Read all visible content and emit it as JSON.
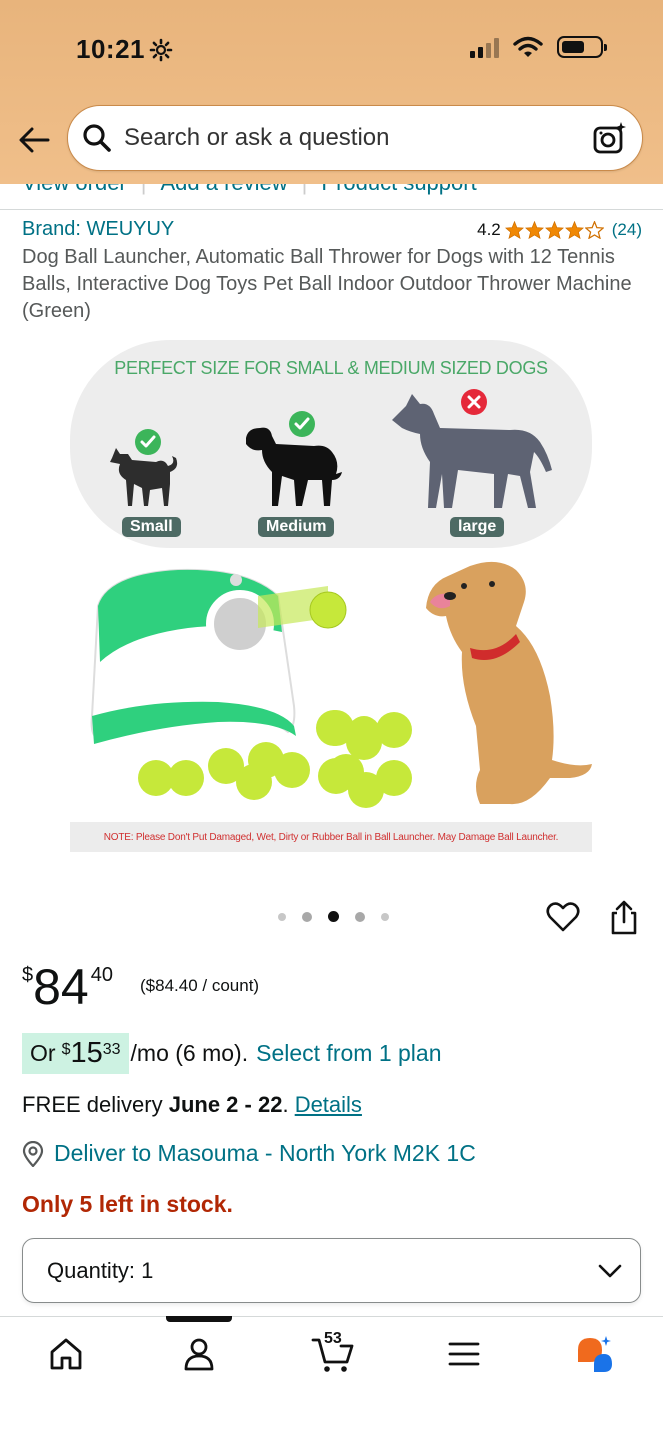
{
  "status_bar": {
    "time": "10:21"
  },
  "search": {
    "placeholder": "Search or ask a question"
  },
  "top_links": [
    "View order",
    "Add a review",
    "Product support"
  ],
  "product": {
    "brand": "Brand: WEUYUY",
    "rating_value": "4.2",
    "rating_stars": 4.2,
    "rating_count": "(24)",
    "title": "Dog Ball Launcher, Automatic Ball Thrower for Dogs with 12 Tennis Balls, Interactive Dog Toys Pet Ball Indoor Outdoor Thrower Machine (Green)"
  },
  "image": {
    "heading": "PERFECT SIZE FOR SMALL & MEDIUM SIZED DOGS",
    "size_labels": [
      "Small",
      "Medium",
      "large"
    ],
    "note": "NOTE: Please Don't Put Damaged, Wet, Dirty or Rubber Ball in Ball Launcher. May Damage Ball Launcher.",
    "carousel_total": 5,
    "carousel_active": 3
  },
  "price": {
    "currency": "$",
    "whole": "84",
    "fraction": "40",
    "unit": "($84.40 / count)"
  },
  "installment": {
    "or": "Or",
    "currency": "$",
    "whole": "15",
    "fraction": "33",
    "rest": "/mo (6 mo).",
    "link": "Select from 1 plan"
  },
  "delivery": {
    "prefix": "FREE delivery",
    "dates": "June 2 - 22",
    "period": ".",
    "details": "Details"
  },
  "deliver_to": "Deliver to Masouma - North York M2K 1C",
  "stock": "Only 5 left in stock.",
  "quantity": {
    "label": "Quantity:",
    "value": "1"
  },
  "bottom_nav": {
    "cart_count": "53",
    "items": [
      "home-icon",
      "account-icon",
      "cart-icon",
      "menu-icon",
      "rufus-icon"
    ]
  },
  "colors": {
    "header": "#f0bf8a",
    "link": "#007185",
    "stock": "#b12704",
    "star": "#f08804",
    "installment_bg": "#cdf2e2"
  }
}
